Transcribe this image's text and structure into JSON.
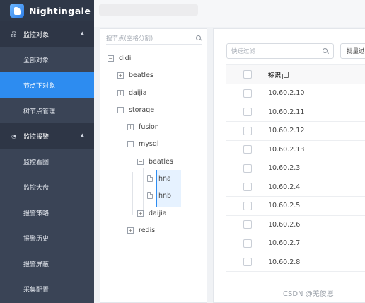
{
  "brand": {
    "name": "Nightingale"
  },
  "sidebar": {
    "groups": [
      {
        "label": "监控对象",
        "icon": "objects-icon",
        "expanded": true,
        "items": [
          {
            "label": "全部对象"
          },
          {
            "label": "节点下对象",
            "active": true
          },
          {
            "label": "树节点管理"
          }
        ]
      },
      {
        "label": "监控报警",
        "icon": "alarm-icon",
        "expanded": true,
        "items": [
          {
            "label": "监控看图"
          },
          {
            "label": "监控大盘"
          },
          {
            "label": "报警策略"
          },
          {
            "label": "报警历史"
          },
          {
            "label": "报警屏蔽"
          },
          {
            "label": "采集配置"
          }
        ]
      }
    ]
  },
  "tree": {
    "search_placeholder": "搜节点(空格分割)",
    "nodes": [
      {
        "label": "didi",
        "toggle": "−"
      },
      {
        "label": "beatles",
        "toggle": "+"
      },
      {
        "label": "daijia",
        "toggle": "+"
      },
      {
        "label": "storage",
        "toggle": "−"
      },
      {
        "label": "fusion",
        "toggle": "+"
      },
      {
        "label": "mysql",
        "toggle": "−"
      },
      {
        "label": "beatles",
        "toggle": "−"
      },
      {
        "label": "hna",
        "toggle": "file",
        "selected": true
      },
      {
        "label": "hnb",
        "toggle": "file"
      },
      {
        "label": "daijia",
        "toggle": "+"
      },
      {
        "label": "redis",
        "toggle": "+"
      }
    ]
  },
  "main": {
    "filter_placeholder": "快速过滤",
    "batch_button": "批量过",
    "table": {
      "header": "标识",
      "rows": [
        "10.60.2.10",
        "10.60.2.11",
        "10.60.2.12",
        "10.60.2.13",
        "10.60.2.3",
        "10.60.2.4",
        "10.60.2.5",
        "10.60.2.6",
        "10.60.2.7",
        "10.60.2.8"
      ]
    }
  },
  "watermark": "CSDN @羌俊恩",
  "colors": {
    "sidebar": "#3a4456",
    "active": "#2d8cf0"
  }
}
